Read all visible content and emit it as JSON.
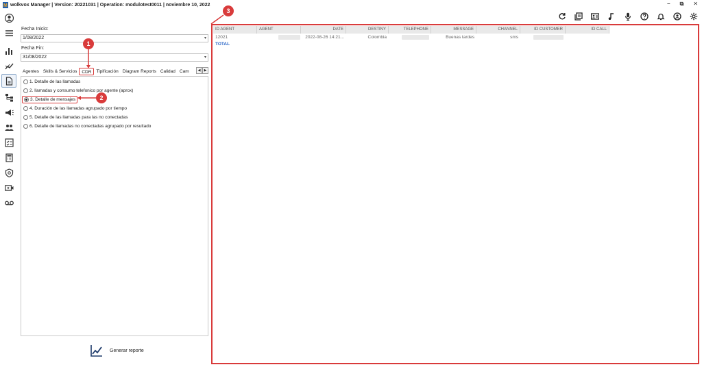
{
  "window": {
    "title": "wolkvox Manager  | Version: 20221031  |  Operation: modulotest0011  |  noviembre 10, 2022",
    "minimize": "–",
    "restore": "⧉",
    "close": "✕"
  },
  "toolbar": {
    "icons": [
      "refresh-icon",
      "book-icon",
      "contact-card-icon",
      "music-note-icon",
      "microphone-icon",
      "help-icon",
      "bell-icon",
      "user-circle-icon",
      "gear-icon"
    ]
  },
  "sidebar": {
    "items": [
      "avatar-icon",
      "menu-icon",
      "bar-chart-icon",
      "trend-icon",
      "report-icon",
      "flow-icon",
      "megaphone-icon",
      "users-icon",
      "checklist-icon",
      "calculator-icon",
      "shield-icon",
      "video-icon",
      "voicemail-icon"
    ],
    "active_index": 4
  },
  "filters": {
    "start_label": "Fecha Inicio:",
    "start_value": "1/08/2022",
    "end_label": "Fecha Fin:",
    "end_value": "31/08/2022"
  },
  "tabs": [
    "Agentes",
    "Skills & Servicios",
    "CDR",
    "Tipificación",
    "Diagram Reports",
    "Calidad",
    "Cam"
  ],
  "selected_tab": "CDR",
  "options": [
    "1. Detalle de las llamadas",
    "2. llamadas y consumo telefonico por agente (aprox)",
    "3. Detalle de mensajes",
    "4. Duración de las llamadas agrupado por tiempo",
    "5. Detalle de las llamadas para las no conectadas",
    "6. Detalle de llamadas no conectadas agrupado por resultado"
  ],
  "selected_option_index": 2,
  "generate_button": "Generar reporte",
  "grid": {
    "columns": [
      "ID AGENT",
      "AGENT",
      "DATE",
      "DESTINY",
      "TELEPHONE",
      "MESSAGE",
      "CHANNEL",
      "ID CUSTOMER",
      "ID CALL"
    ],
    "row": {
      "id_agent": "12021",
      "date": "2022-08-26 14:21...",
      "destiny": "Colombia",
      "message": "Buenas tardes",
      "channel": "sms"
    },
    "total_label": "TOTAL"
  },
  "callouts": [
    "1",
    "2",
    "3"
  ],
  "colors": {
    "annotation": "#d93b3b",
    "total": "#2a66c7"
  }
}
